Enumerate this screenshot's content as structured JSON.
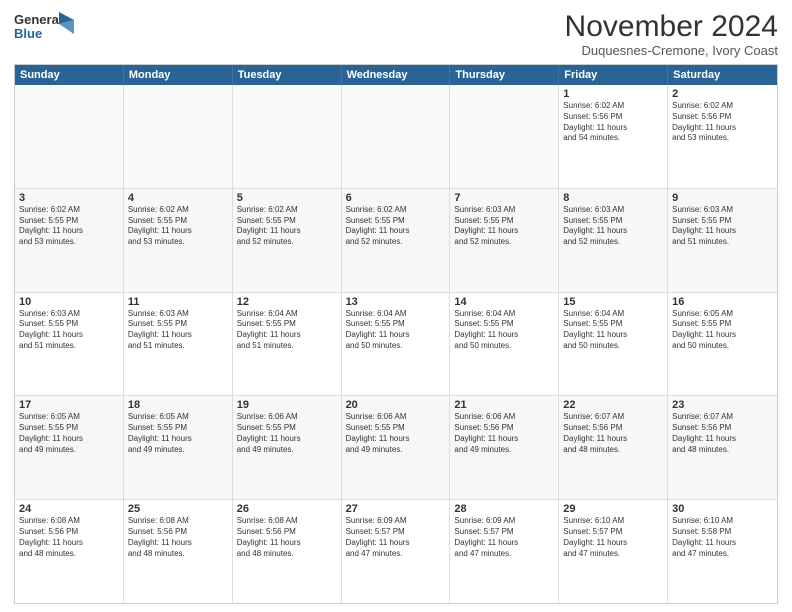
{
  "logo": {
    "line1": "General",
    "line2": "Blue",
    "icon_color": "#2a6496"
  },
  "header": {
    "month": "November 2024",
    "location": "Duquesnes-Cremone, Ivory Coast"
  },
  "days_of_week": [
    "Sunday",
    "Monday",
    "Tuesday",
    "Wednesday",
    "Thursday",
    "Friday",
    "Saturday"
  ],
  "weeks": [
    [
      {
        "day": "",
        "text": ""
      },
      {
        "day": "",
        "text": ""
      },
      {
        "day": "",
        "text": ""
      },
      {
        "day": "",
        "text": ""
      },
      {
        "day": "",
        "text": ""
      },
      {
        "day": "1",
        "text": "Sunrise: 6:02 AM\nSunset: 5:56 PM\nDaylight: 11 hours\nand 54 minutes."
      },
      {
        "day": "2",
        "text": "Sunrise: 6:02 AM\nSunset: 5:56 PM\nDaylight: 11 hours\nand 53 minutes."
      }
    ],
    [
      {
        "day": "3",
        "text": "Sunrise: 6:02 AM\nSunset: 5:55 PM\nDaylight: 11 hours\nand 53 minutes."
      },
      {
        "day": "4",
        "text": "Sunrise: 6:02 AM\nSunset: 5:55 PM\nDaylight: 11 hours\nand 53 minutes."
      },
      {
        "day": "5",
        "text": "Sunrise: 6:02 AM\nSunset: 5:55 PM\nDaylight: 11 hours\nand 52 minutes."
      },
      {
        "day": "6",
        "text": "Sunrise: 6:02 AM\nSunset: 5:55 PM\nDaylight: 11 hours\nand 52 minutes."
      },
      {
        "day": "7",
        "text": "Sunrise: 6:03 AM\nSunset: 5:55 PM\nDaylight: 11 hours\nand 52 minutes."
      },
      {
        "day": "8",
        "text": "Sunrise: 6:03 AM\nSunset: 5:55 PM\nDaylight: 11 hours\nand 52 minutes."
      },
      {
        "day": "9",
        "text": "Sunrise: 6:03 AM\nSunset: 5:55 PM\nDaylight: 11 hours\nand 51 minutes."
      }
    ],
    [
      {
        "day": "10",
        "text": "Sunrise: 6:03 AM\nSunset: 5:55 PM\nDaylight: 11 hours\nand 51 minutes."
      },
      {
        "day": "11",
        "text": "Sunrise: 6:03 AM\nSunset: 5:55 PM\nDaylight: 11 hours\nand 51 minutes."
      },
      {
        "day": "12",
        "text": "Sunrise: 6:04 AM\nSunset: 5:55 PM\nDaylight: 11 hours\nand 51 minutes."
      },
      {
        "day": "13",
        "text": "Sunrise: 6:04 AM\nSunset: 5:55 PM\nDaylight: 11 hours\nand 50 minutes."
      },
      {
        "day": "14",
        "text": "Sunrise: 6:04 AM\nSunset: 5:55 PM\nDaylight: 11 hours\nand 50 minutes."
      },
      {
        "day": "15",
        "text": "Sunrise: 6:04 AM\nSunset: 5:55 PM\nDaylight: 11 hours\nand 50 minutes."
      },
      {
        "day": "16",
        "text": "Sunrise: 6:05 AM\nSunset: 5:55 PM\nDaylight: 11 hours\nand 50 minutes."
      }
    ],
    [
      {
        "day": "17",
        "text": "Sunrise: 6:05 AM\nSunset: 5:55 PM\nDaylight: 11 hours\nand 49 minutes."
      },
      {
        "day": "18",
        "text": "Sunrise: 6:05 AM\nSunset: 5:55 PM\nDaylight: 11 hours\nand 49 minutes."
      },
      {
        "day": "19",
        "text": "Sunrise: 6:06 AM\nSunset: 5:55 PM\nDaylight: 11 hours\nand 49 minutes."
      },
      {
        "day": "20",
        "text": "Sunrise: 6:06 AM\nSunset: 5:55 PM\nDaylight: 11 hours\nand 49 minutes."
      },
      {
        "day": "21",
        "text": "Sunrise: 6:06 AM\nSunset: 5:56 PM\nDaylight: 11 hours\nand 49 minutes."
      },
      {
        "day": "22",
        "text": "Sunrise: 6:07 AM\nSunset: 5:56 PM\nDaylight: 11 hours\nand 48 minutes."
      },
      {
        "day": "23",
        "text": "Sunrise: 6:07 AM\nSunset: 5:56 PM\nDaylight: 11 hours\nand 48 minutes."
      }
    ],
    [
      {
        "day": "24",
        "text": "Sunrise: 6:08 AM\nSunset: 5:56 PM\nDaylight: 11 hours\nand 48 minutes."
      },
      {
        "day": "25",
        "text": "Sunrise: 6:08 AM\nSunset: 5:56 PM\nDaylight: 11 hours\nand 48 minutes."
      },
      {
        "day": "26",
        "text": "Sunrise: 6:08 AM\nSunset: 5:56 PM\nDaylight: 11 hours\nand 48 minutes."
      },
      {
        "day": "27",
        "text": "Sunrise: 6:09 AM\nSunset: 5:57 PM\nDaylight: 11 hours\nand 47 minutes."
      },
      {
        "day": "28",
        "text": "Sunrise: 6:09 AM\nSunset: 5:57 PM\nDaylight: 11 hours\nand 47 minutes."
      },
      {
        "day": "29",
        "text": "Sunrise: 6:10 AM\nSunset: 5:57 PM\nDaylight: 11 hours\nand 47 minutes."
      },
      {
        "day": "30",
        "text": "Sunrise: 6:10 AM\nSunset: 5:58 PM\nDaylight: 11 hours\nand 47 minutes."
      }
    ]
  ]
}
